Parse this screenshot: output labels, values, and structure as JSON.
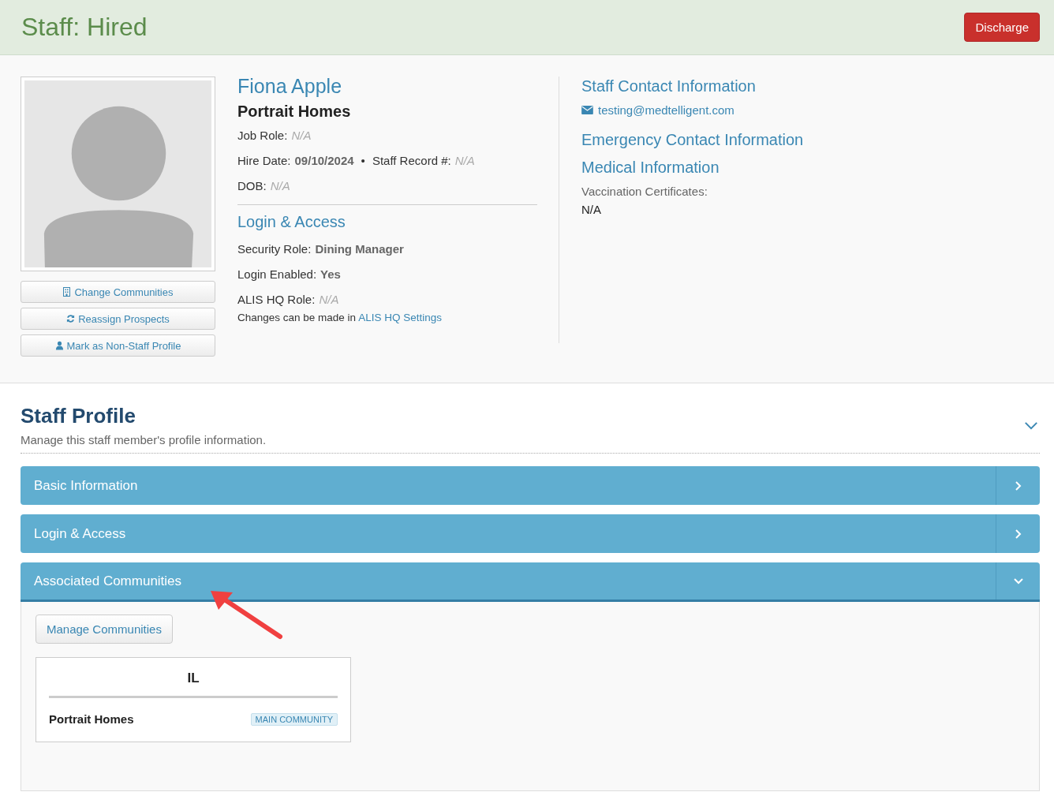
{
  "header": {
    "title": "Staff: Hired",
    "action": "Discharge"
  },
  "profile": {
    "buttons": [
      {
        "kind": "building",
        "label": "Change Communities"
      },
      {
        "kind": "refresh",
        "label": "Reassign Prospects"
      },
      {
        "kind": "user",
        "label": "Mark as Non-Staff Profile"
      }
    ],
    "name": "Fiona Apple",
    "community": "Portrait Homes",
    "details": [
      {
        "pairs": [
          {
            "label": "Job Role:",
            "value": "N/A",
            "kind": "missing"
          }
        ]
      },
      {
        "pairs": [
          {
            "label": "Hire Date:",
            "value": "09/10/2024",
            "kind": "set"
          },
          {
            "separator": "•",
            "label": "Staff Record #:",
            "value": "N/A",
            "kind": "missing"
          }
        ]
      },
      {
        "pairs": [
          {
            "label": "DOB:",
            "value": "N/A",
            "kind": "missing"
          }
        ]
      }
    ],
    "login_title": "Login & Access",
    "login": [
      {
        "pairs": [
          {
            "label": "Security Role:",
            "value": "Dining Manager",
            "kind": "set"
          }
        ]
      },
      {
        "pairs": [
          {
            "label": "Login Enabled:",
            "value": "Yes",
            "kind": "set"
          }
        ]
      },
      {
        "pairs": [
          {
            "label": "ALIS HQ Role:",
            "value": "N/A",
            "kind": "missing"
          }
        ]
      }
    ],
    "note": "Changes can be made in",
    "note_link": "ALIS HQ Settings",
    "contact_title": "Staff Contact Information",
    "email": "testing@medtelligent.com",
    "emergency_title": "Emergency Contact Information",
    "medical_title": "Medical Information",
    "vaccination_label": "Vaccination Certificates:",
    "vaccination_value": "N/A"
  },
  "staff_profile": {
    "title": "Staff Profile",
    "subtitle": "Manage this staff member's profile information.",
    "expanded": true,
    "sections": [
      {
        "title": "Basic Information",
        "expanded": false
      },
      {
        "title": "Login & Access",
        "expanded": false
      },
      {
        "title": "Associated Communities",
        "expanded": true
      }
    ],
    "manage_button": "Manage Communities",
    "community_card": {
      "heading": "IL",
      "name": "Portrait Homes",
      "badge": "MAIN COMMUNITY"
    }
  }
}
